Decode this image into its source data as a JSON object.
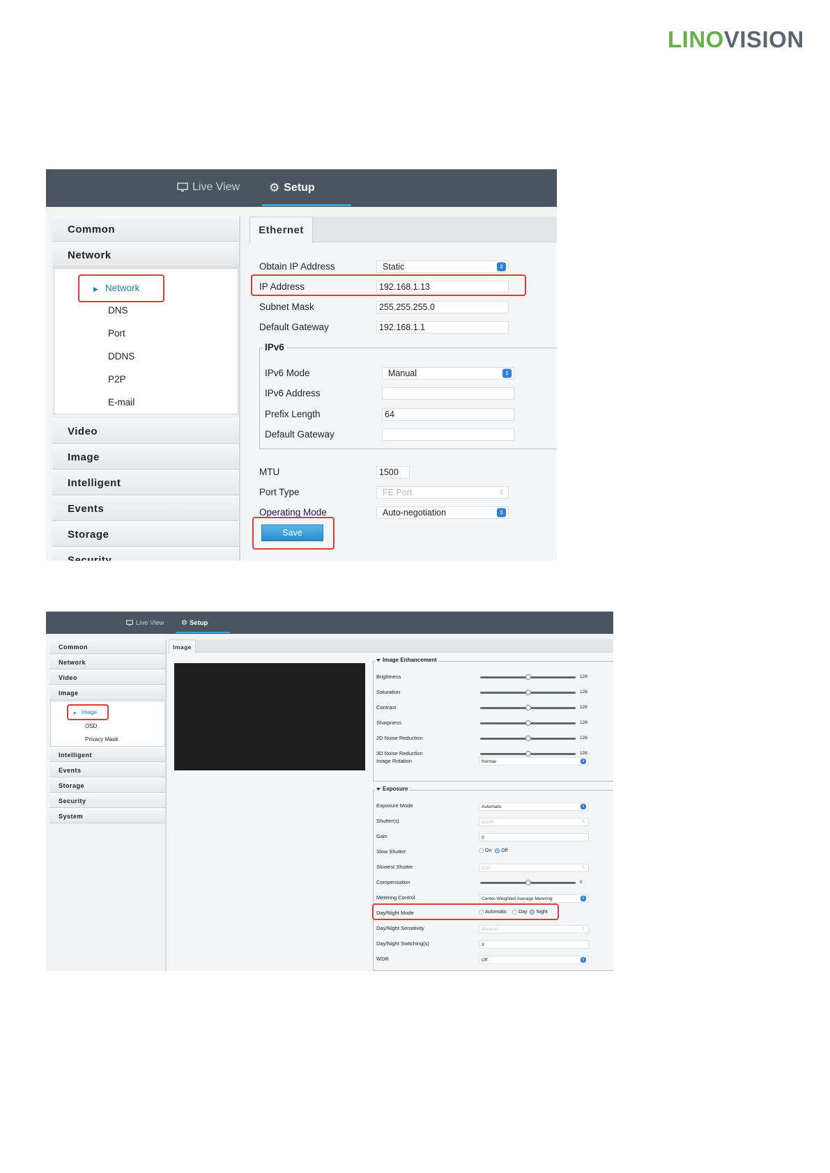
{
  "logo": {
    "lino": "LINO",
    "vision": "VISION"
  },
  "shot1": {
    "nav": {
      "live_view": "Live View",
      "setup": "Setup",
      "live_view_icon": "monitor-icon",
      "setup_icon": "gear-icon"
    },
    "sidebar": {
      "common": "Common",
      "network": "Network",
      "sub_items": [
        "Network",
        "DNS",
        "Port",
        "DDNS",
        "P2P",
        "E-mail"
      ],
      "rest": [
        "Video",
        "Image",
        "Intelligent",
        "Events",
        "Storage",
        "Security"
      ]
    },
    "tab": "Ethernet",
    "form": {
      "obtain_ip_label": "Obtain IP Address",
      "obtain_ip_value": "Static",
      "ip_label": "IP Address",
      "ip_value": "192.168.1.13",
      "subnet_label": "Subnet Mask",
      "subnet_value": "255.255.255.0",
      "gateway_label": "Default Gateway",
      "gateway_value": "192.168.1.1",
      "ipv6_legend": "IPv6",
      "ipv6_mode_label": "IPv6 Mode",
      "ipv6_mode_value": "Manual",
      "ipv6_address_label": "IPv6 Address",
      "ipv6_address_value": "",
      "prefix_label": "Prefix Length",
      "prefix_value": "64",
      "ipv6_gateway_label": "Default Gateway",
      "ipv6_gateway_value": "",
      "mtu_label": "MTU",
      "mtu_value": "1500",
      "port_type_label": "Port Type",
      "port_type_value": "FE Port",
      "operating_mode_label": "Operating Mode",
      "operating_mode_value": "Auto-negotiation",
      "save": "Save"
    }
  },
  "shot2": {
    "nav": {
      "live_view": "Live View",
      "setup": "Setup"
    },
    "sidebar": {
      "top": [
        "Common",
        "Network",
        "Video",
        "Image"
      ],
      "sub_items": [
        "Image",
        "OSD",
        "Privacy Mask"
      ],
      "rest": [
        "Intelligent",
        "Events",
        "Storage",
        "Security",
        "System"
      ]
    },
    "tab": "Image",
    "enhancement": {
      "legend": "Image Enhancement",
      "rows": [
        {
          "label": "Brightness",
          "value": "128",
          "level": 0.5
        },
        {
          "label": "Saturation",
          "value": "128",
          "level": 0.5
        },
        {
          "label": "Contrast",
          "value": "128",
          "level": 0.5
        },
        {
          "label": "Sharpness",
          "value": "128",
          "level": 0.5
        },
        {
          "label": "2D Noise Reduction",
          "value": "128",
          "level": 0.5
        },
        {
          "label": "3D Noise Reduction",
          "value": "128",
          "level": 0.5
        }
      ],
      "rotation_label": "Image Rotation",
      "rotation_value": "Normal"
    },
    "exposure": {
      "legend": "Exposure",
      "mode_label": "Exposure Mode",
      "mode_value": "Automatic",
      "shutter_label": "Shutter(s)",
      "shutter_value": "1/100",
      "gain_label": "Gain",
      "gain_value": "0",
      "slow_shutter_label": "Slow Shutter",
      "slow_on": "On",
      "slow_off": "Off",
      "slowest_label": "Slowest Shutter",
      "slowest_value": "1/12",
      "compensation_label": "Compensation",
      "compensation_value": "0",
      "compensation_level": 0.5,
      "metering_label": "Metering Control",
      "metering_value": "Center-Weighted Average Metering",
      "daynight_label": "Day/Night Mode",
      "dn_auto": "Automatic",
      "dn_day": "Day",
      "dn_night": "Night",
      "sensitivity_label": "Day/Night Sensitivity",
      "sensitivity_value": "Medium",
      "switching_label": "Day/Night Switching(s)",
      "switching_value": "3",
      "wdr_label": "WDR",
      "wdr_value": "Off"
    }
  }
}
